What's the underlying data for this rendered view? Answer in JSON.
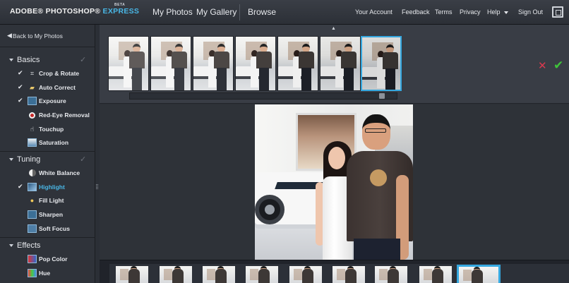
{
  "app": {
    "brand": "ADOBE® PHOTOSHOP®",
    "brand_accent": "EXPRESS",
    "beta": "BETA"
  },
  "main_nav": [
    {
      "label": "My Photos"
    },
    {
      "label": "My Gallery"
    },
    {
      "label": "Browse"
    }
  ],
  "right_nav": [
    {
      "label": "Your Account"
    },
    {
      "label": "Feedback"
    },
    {
      "label": "Terms"
    },
    {
      "label": "Privacy"
    },
    {
      "label": "Help"
    },
    {
      "label": "Sign Out"
    }
  ],
  "sidebar": {
    "back_label": "Back to My Photos",
    "sections": [
      {
        "title": "Basics",
        "tools": [
          {
            "label": "Crop & Rotate",
            "icon": "crop-icon",
            "checked": true
          },
          {
            "label": "Auto Correct",
            "icon": "magic-wand-icon",
            "checked": true
          },
          {
            "label": "Exposure",
            "icon": "exposure-icon",
            "checked": true
          },
          {
            "label": "Red-Eye Removal",
            "icon": "red-eye-icon",
            "checked": false
          },
          {
            "label": "Touchup",
            "icon": "hand-icon",
            "checked": false
          },
          {
            "label": "Saturation",
            "icon": "saturation-icon",
            "checked": false
          }
        ]
      },
      {
        "title": "Tuning",
        "tools": [
          {
            "label": "White Balance",
            "icon": "white-balance-icon",
            "checked": false
          },
          {
            "label": "Highlight",
            "icon": "highlight-icon",
            "checked": true,
            "active": true
          },
          {
            "label": "Fill Light",
            "icon": "light-bulb-icon",
            "checked": false
          },
          {
            "label": "Sharpen",
            "icon": "sharpen-icon",
            "checked": false
          },
          {
            "label": "Soft Focus",
            "icon": "soft-focus-icon",
            "checked": false
          }
        ]
      },
      {
        "title": "Effects",
        "tools": [
          {
            "label": "Pop Color",
            "icon": "pop-color-icon",
            "checked": false
          },
          {
            "label": "Hue",
            "icon": "hue-icon",
            "checked": false
          }
        ]
      }
    ]
  },
  "variations": {
    "count": 7,
    "selected_index": 6
  },
  "gallery": {
    "count": 9,
    "selected_index": 8
  },
  "colors": {
    "accent": "#35a8e0",
    "cancel": "#d9394f",
    "apply": "#3fc43a",
    "background": "#2b2f36"
  }
}
